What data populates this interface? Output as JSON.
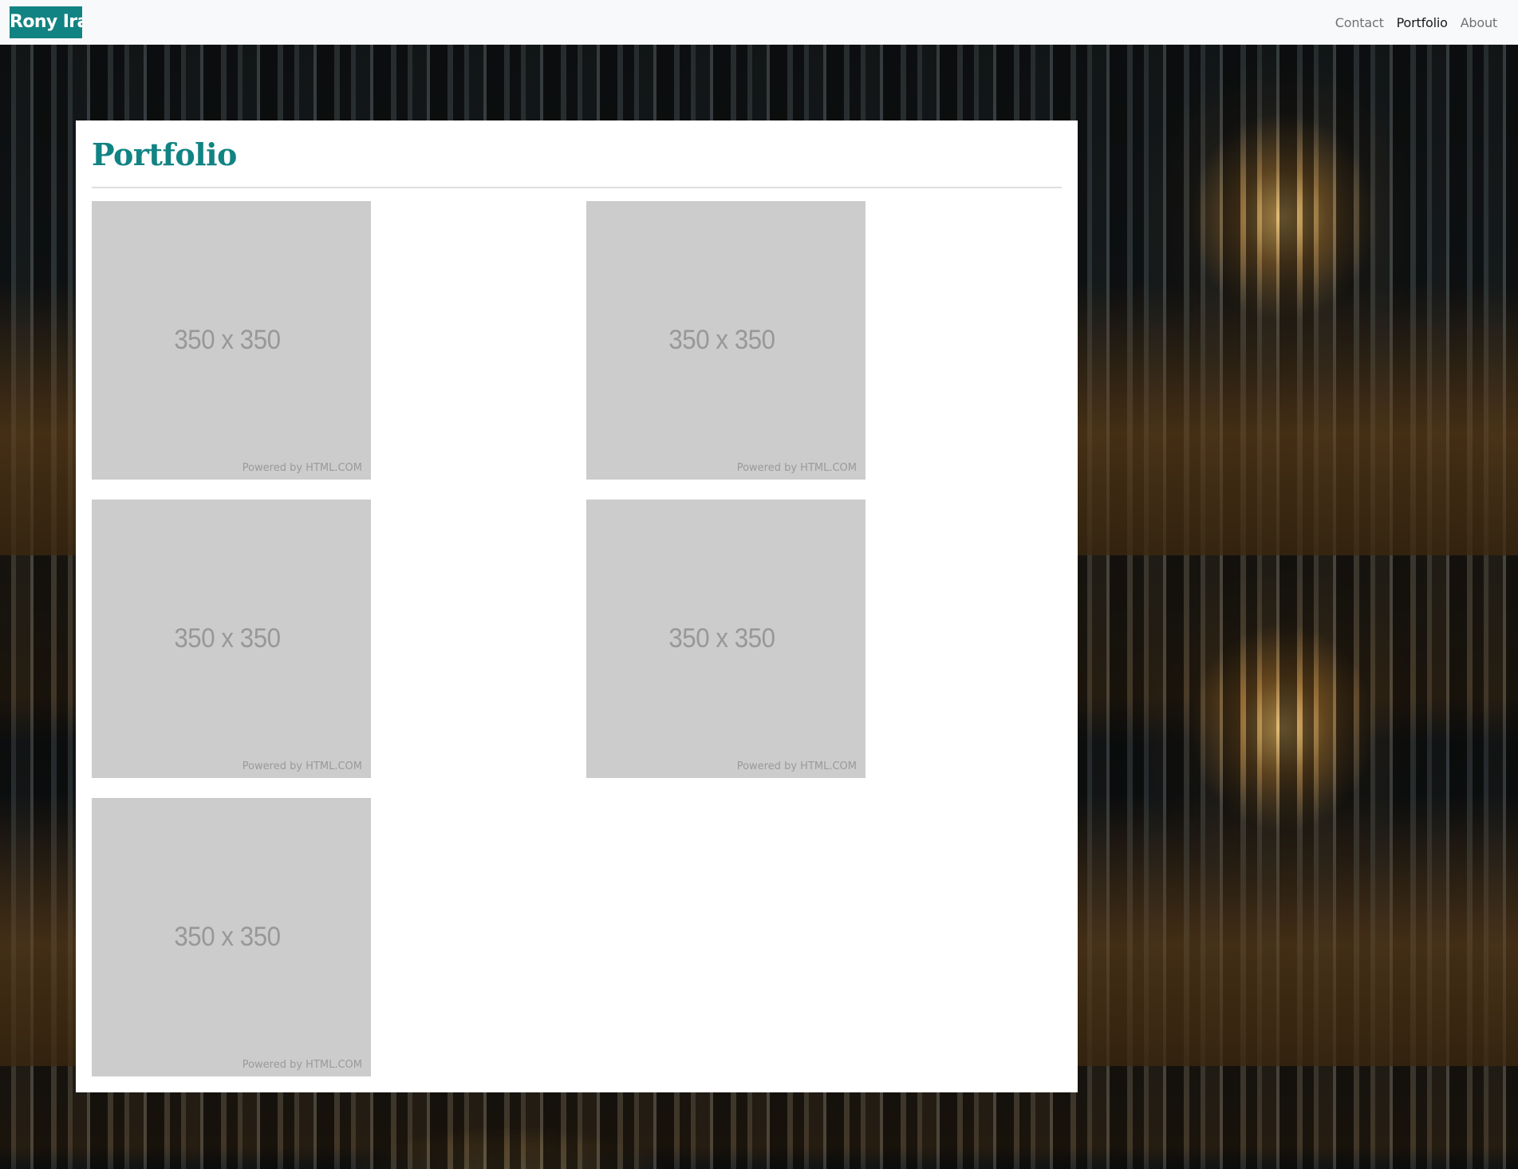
{
  "navbar": {
    "brand": "Rony Iraq",
    "links": [
      "Contact",
      "Portfolio",
      "About"
    ],
    "active": "Portfolio",
    "brand_color": "#128383"
  },
  "page": {
    "title": "Portfolio"
  },
  "portfolio": {
    "items": [
      {
        "label": "350 x 350",
        "credit": "Powered by HTML.COM"
      },
      {
        "label": "350 x 350",
        "credit": "Powered by HTML.COM"
      },
      {
        "label": "350 x 350",
        "credit": "Powered by HTML.COM"
      },
      {
        "label": "350 x 350",
        "credit": "Powered by HTML.COM"
      },
      {
        "label": "350 x 350",
        "credit": "Powered by HTML.COM"
      }
    ]
  },
  "colors": {
    "accent": "#128383",
    "placeholder": "#cccccc"
  }
}
